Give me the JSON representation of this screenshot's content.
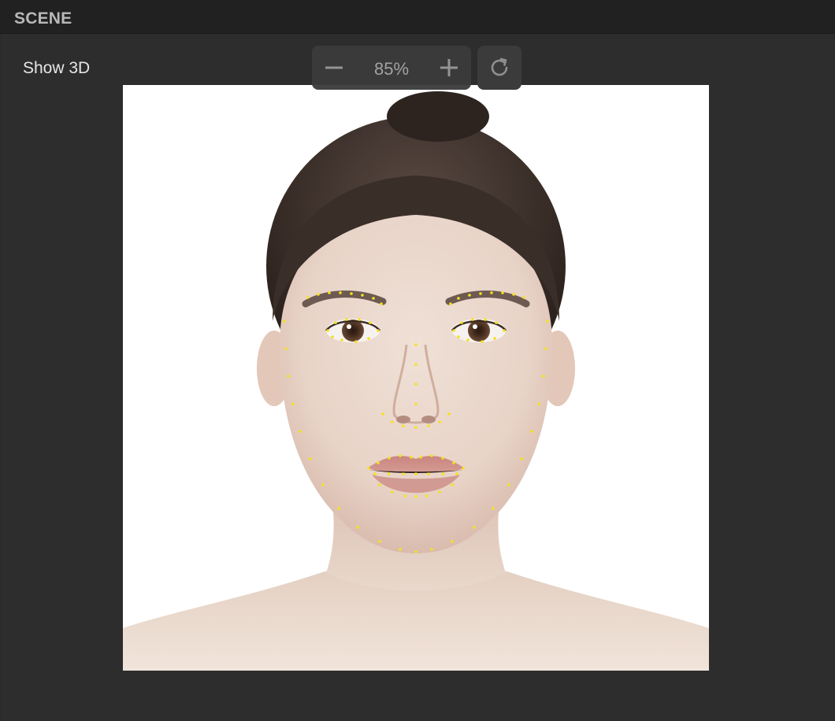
{
  "panel": {
    "title": "SCENE"
  },
  "toolbar": {
    "show_3d_label": "Show 3D",
    "zoom_value": "85%",
    "zoom_out_icon": "minus-icon",
    "zoom_in_icon": "plus-icon",
    "reset_icon": "refresh-icon"
  },
  "viewport": {
    "content": "face-portrait-image",
    "landmark_color": "#f5e21a",
    "background": "#ffffff"
  }
}
